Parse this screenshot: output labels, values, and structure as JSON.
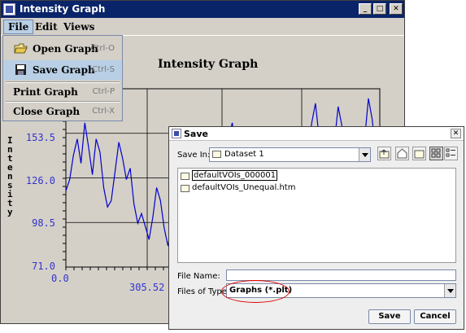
{
  "window": {
    "title": "Intensity Graph"
  },
  "menubar": {
    "items": [
      "File",
      "Edit",
      "Views"
    ]
  },
  "file_menu": {
    "items": [
      {
        "label": "Open Graph",
        "shortcut": "Ctrl-O",
        "icon": "open-folder-icon"
      },
      {
        "label": "Save Graph",
        "shortcut": "Ctrl-S",
        "icon": "floppy-disk-icon"
      },
      {
        "label": "Print Graph",
        "shortcut": "Ctrl-P"
      },
      {
        "label": "Close Graph",
        "shortcut": "Ctrl-X"
      }
    ],
    "highlighted": "Save Graph"
  },
  "graph": {
    "title": "Intensity Graph",
    "ylabel": "Intensity",
    "line_color": "#0000cc",
    "tick_color": "#3333cc"
  },
  "chart_data": {
    "type": "line",
    "title": "Intensity Graph",
    "xlabel": "",
    "ylabel": "Intensity",
    "yticks": [
      "153.5",
      "126.0",
      "98.5",
      "71.0"
    ],
    "xticks": [
      "0.0",
      "305.52"
    ],
    "ylim": [
      71.0,
      181.0
    ],
    "xlim": [
      0,
      611.04
    ],
    "grid": true,
    "series": [
      {
        "values": [
          118,
          125,
          140,
          150,
          135,
          160,
          145,
          128,
          150,
          142,
          120,
          108,
          112,
          130,
          148,
          138,
          125,
          132,
          110,
          98,
          104,
          96,
          88,
          102,
          120,
          112,
          95,
          84,
          100,
          118,
          108,
          92,
          80,
          96,
          110,
          118,
          105,
          126,
          140,
          122,
          110,
          130,
          145,
          150,
          160,
          142,
          128,
          118,
          110,
          96,
          90,
          78,
          82,
          100,
          115,
          95,
          80,
          72,
          88,
          110,
          96,
          86,
          100,
          125,
          140,
          160,
          172,
          150,
          128,
          118,
          135,
          148,
          170,
          158,
          140,
          120,
          104,
          112,
          130,
          150,
          175,
          162,
          140,
          128
        ]
      }
    ]
  },
  "save_dialog": {
    "title": "Save",
    "save_in_label": "Save In:",
    "save_in_value": "Dataset 1",
    "files": [
      "defaultVOIs_000001",
      "defaultVOIs_Unequal.htm"
    ],
    "selected_file": "defaultVOIs_000001",
    "file_name_label": "File Name:",
    "file_name_value": "",
    "file_type_label": "Files of Type:",
    "file_type_value": "Graphs (*.plt)",
    "save_button": "Save",
    "cancel_button": "Cancel",
    "highlight_color": "#e00000"
  }
}
